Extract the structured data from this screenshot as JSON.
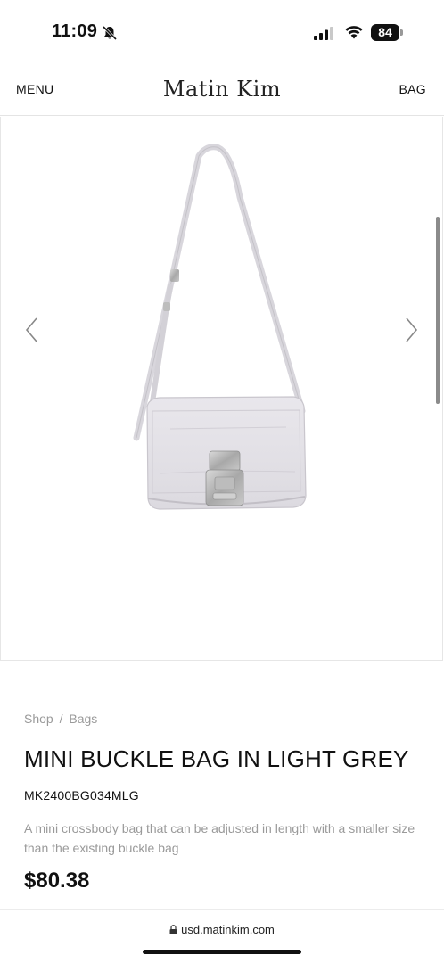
{
  "status_bar": {
    "time": "11:09",
    "battery": "84"
  },
  "header": {
    "menu_label": "MENU",
    "logo": "Matin Kim",
    "bag_label": "BAG"
  },
  "breadcrumb": {
    "shop": "Shop",
    "separator": "/",
    "category": "Bags"
  },
  "product": {
    "title": "MINI BUCKLE BAG IN LIGHT GREY",
    "sku": "MK2400BG034MLG",
    "description": "A mini crossbody bag that can be adjusted in length with a smaller size than the existing buckle bag",
    "price": "$80.38"
  },
  "browser": {
    "url": "usd.matinkim.com"
  },
  "icons": {
    "bell": "bell-slash-icon",
    "signal": "cellular-signal-icon",
    "wifi": "wifi-icon",
    "prev": "chevron-left-icon",
    "next": "chevron-right-icon",
    "lock": "lock-icon"
  },
  "colors": {
    "text": "#111111",
    "muted": "#9a9a9a",
    "bag": "#e3e1e6"
  }
}
